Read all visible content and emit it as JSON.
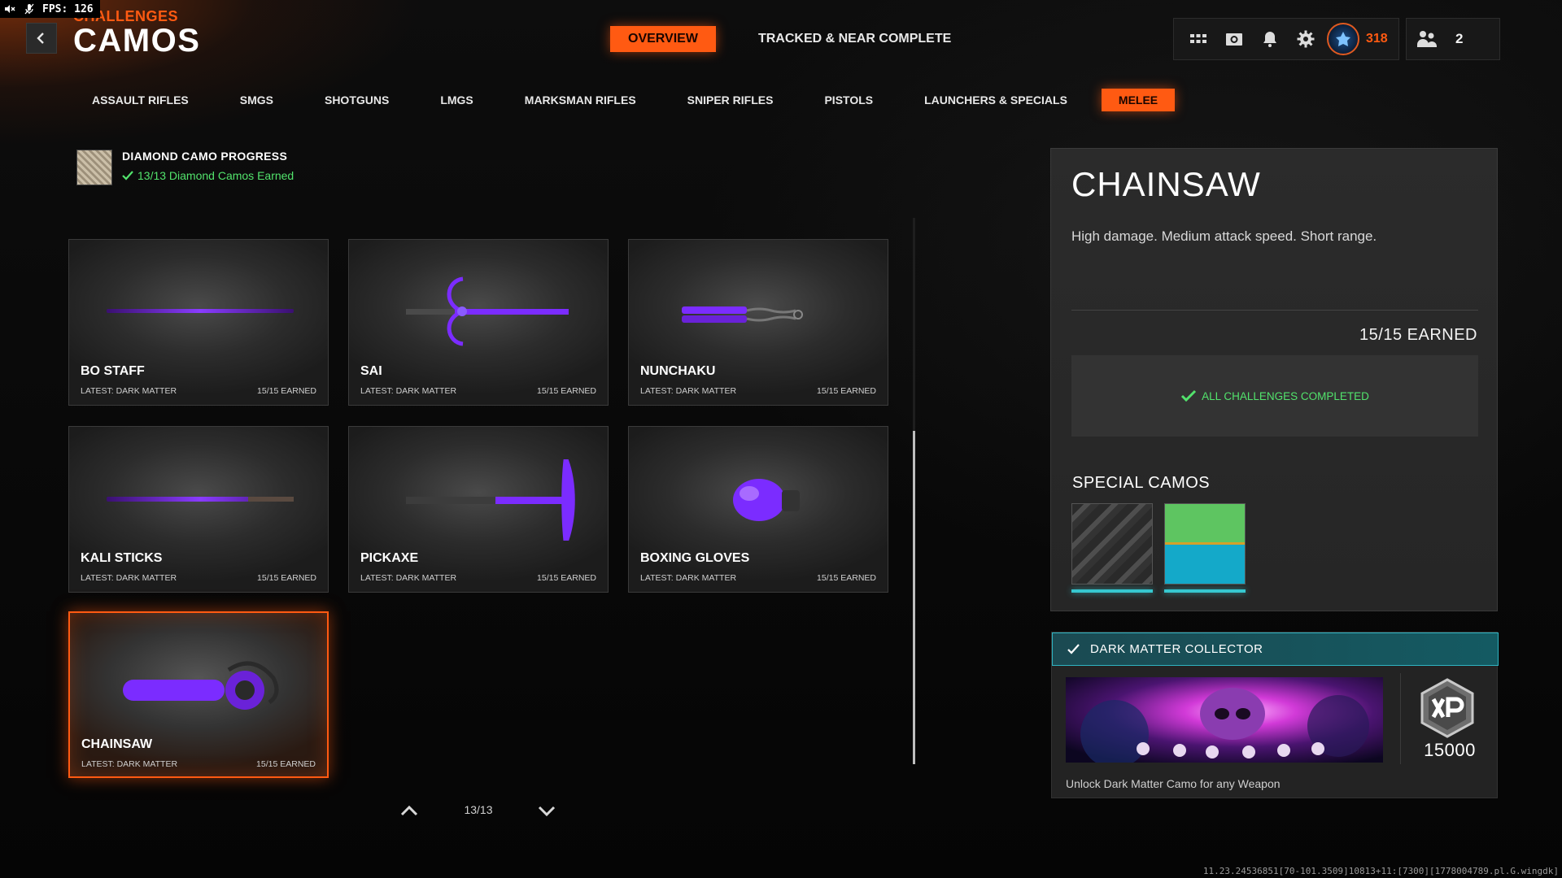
{
  "os_overlay": {
    "fps_label": "FPS:",
    "fps_value": "126"
  },
  "header": {
    "breadcrumb": "CHALLENGES",
    "title": "CAMOS",
    "top_tabs": [
      {
        "label": "OVERVIEW",
        "active": true
      },
      {
        "label": "TRACKED & NEAR COMPLETE",
        "active": false
      }
    ],
    "rank_value": "318",
    "party_count": "2"
  },
  "category_tabs": [
    {
      "label": "ASSAULT RIFLES",
      "active": false
    },
    {
      "label": "SMGS",
      "active": false
    },
    {
      "label": "SHOTGUNS",
      "active": false
    },
    {
      "label": "LMGS",
      "active": false
    },
    {
      "label": "MARKSMAN RIFLES",
      "active": false
    },
    {
      "label": "SNIPER RIFLES",
      "active": false
    },
    {
      "label": "PISTOLS",
      "active": false
    },
    {
      "label": "LAUNCHERS & SPECIALS",
      "active": false
    },
    {
      "label": "MELEE",
      "active": true
    }
  ],
  "diamond_progress": {
    "title": "DIAMOND CAMO PROGRESS",
    "status": "13/13 Diamond Camos Earned"
  },
  "weapons": [
    {
      "name": "BO STAFF",
      "latest": "LATEST: DARK MATTER",
      "earned": "15/15 EARNED",
      "icon": "bo-staff-icon"
    },
    {
      "name": "SAI",
      "latest": "LATEST: DARK MATTER",
      "earned": "15/15 EARNED",
      "icon": "sai-icon"
    },
    {
      "name": "NUNCHAKU",
      "latest": "LATEST: DARK MATTER",
      "earned": "15/15 EARNED",
      "icon": "nunchaku-icon"
    },
    {
      "name": "KALI STICKS",
      "latest": "LATEST: DARK MATTER",
      "earned": "15/15 EARNED",
      "icon": "kali-sticks-icon"
    },
    {
      "name": "PICKAXE",
      "latest": "LATEST: DARK MATTER",
      "earned": "15/15 EARNED",
      "icon": "pickaxe-icon"
    },
    {
      "name": "BOXING GLOVES",
      "latest": "LATEST: DARK MATTER",
      "earned": "15/15 EARNED",
      "icon": "boxing-glove-icon"
    },
    {
      "name": "CHAINSAW",
      "latest": "LATEST: DARK MATTER",
      "earned": "15/15 EARNED",
      "icon": "chainsaw-icon",
      "selected": true
    }
  ],
  "pagination": {
    "label": "13/13"
  },
  "detail": {
    "title": "CHAINSAW",
    "description": "High damage.  Medium attack speed. Short range.",
    "earned": "15/15 EARNED",
    "status": "ALL CHALLENGES COMPLETED",
    "special_camos_title": "SPECIAL CAMOS"
  },
  "collector": {
    "title": "DARK MATTER COLLECTOR",
    "reward_xp": "15000",
    "description": "Unlock Dark Matter Camo for any Weapon"
  },
  "debug_text": "11.23.24536851[70-101.3509]10813+11:[7300][1778004789.pl.G.wingdk]",
  "colors": {
    "accent": "#ff5a12",
    "success": "#52e36c",
    "teal": "#2fb4c2",
    "camo_purple": "#7b2cff"
  }
}
